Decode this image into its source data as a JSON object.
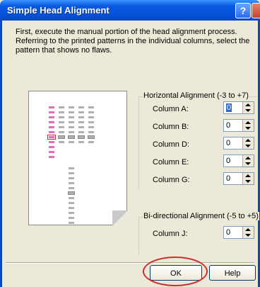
{
  "window": {
    "title": "Simple Head Alignment",
    "help_glyph": "?"
  },
  "instructions": "First, execute the manual portion of the head alignment process. Referring to the printed patterns in the individual columns, select the pattern that shows no flaws.",
  "horizontal": {
    "title": "Horizontal Alignment (-3 to +7)",
    "rows": [
      {
        "label": "Column A:",
        "value": "0"
      },
      {
        "label": "Column B:",
        "value": "0"
      },
      {
        "label": "Column D:",
        "value": "0"
      },
      {
        "label": "Column E:",
        "value": "0"
      },
      {
        "label": "Column G:",
        "value": "0"
      }
    ]
  },
  "bidirectional": {
    "title": "Bi-directional Alignment (-5 to +5)",
    "rows": [
      {
        "label": "Column J:",
        "value": "0"
      }
    ]
  },
  "buttons": {
    "ok": "OK",
    "help": "Help"
  },
  "colors": {
    "pink": "#e070b8",
    "gray": "#b0b0b0",
    "highlight": "#d12b2b"
  }
}
